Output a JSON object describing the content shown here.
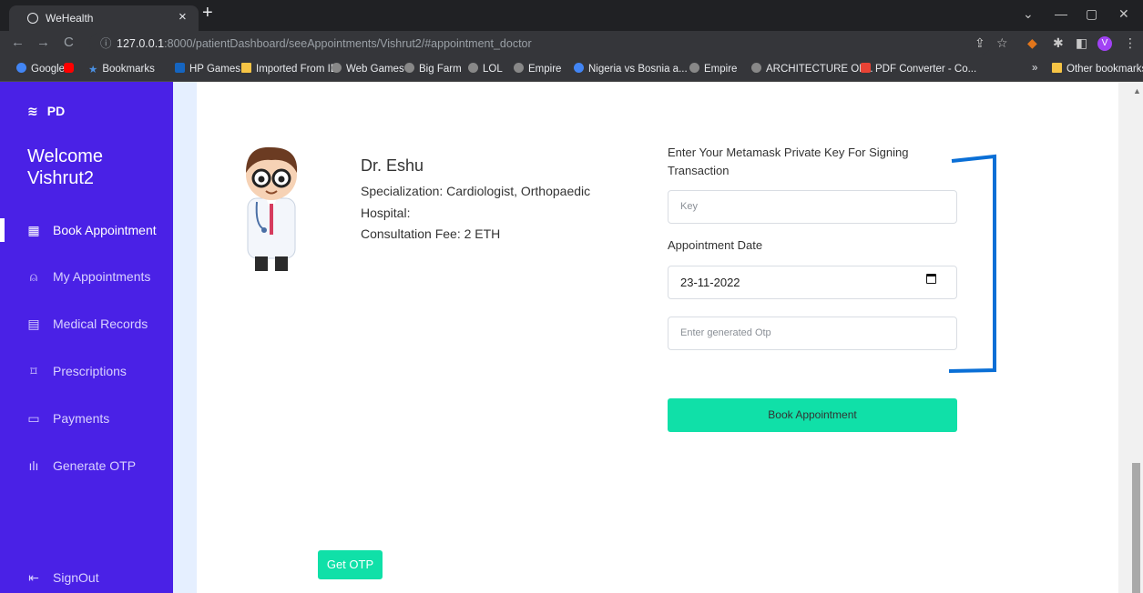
{
  "browser": {
    "tab_title": "WeHealth",
    "url_host": "127.0.0.1",
    "url_path": ":8000/patientDashboard/seeAppointments/Vishrut2/#appointment_doctor",
    "profile_initial": "V",
    "bookmarks": [
      "Google",
      "",
      "Bookmarks",
      "HP Games",
      "Imported From IE",
      "Web Games",
      "Big Farm",
      "LOL",
      "Empire",
      "Nigeria vs Bosnia a...",
      "Empire",
      "ARCHITECTURE OF...",
      "PDF Converter - Co..."
    ],
    "other_bookmarks": "Other bookmarks",
    "overflow": "»"
  },
  "sidebar": {
    "brand": "PD",
    "welcome_line1": "Welcome",
    "welcome_line2": "Vishrut2",
    "items": [
      {
        "label": "Book Appointment",
        "icon": "grid-icon"
      },
      {
        "label": "My Appointments",
        "icon": "user-icon"
      },
      {
        "label": "Medical Records",
        "icon": "document-icon"
      },
      {
        "label": "Prescriptions",
        "icon": "bookmark-icon"
      },
      {
        "label": "Payments",
        "icon": "folder-icon"
      },
      {
        "label": "Generate OTP",
        "icon": "chart-icon"
      }
    ],
    "signout": "SignOut"
  },
  "doctor": {
    "name": "Dr. Eshu",
    "specialization": "Specialization: Cardiologist, Orthopaedic",
    "hospital": "Hospital:",
    "fee": "Consultation Fee: 2 ETH"
  },
  "form": {
    "key_label_line1": "Enter Your Metamask Private Key For Signing",
    "key_label_line2": "Transaction",
    "key_placeholder": "Key",
    "date_label": "Appointment Date",
    "date_value": "23-11-2022",
    "otp_placeholder": "Enter generated Otp",
    "book_button": "Book Appointment",
    "get_otp_button": "Get OTP"
  },
  "colors": {
    "sidebar": "#4a21e6",
    "accent": "#10e0a8",
    "bracket": "#0a6fd6"
  }
}
